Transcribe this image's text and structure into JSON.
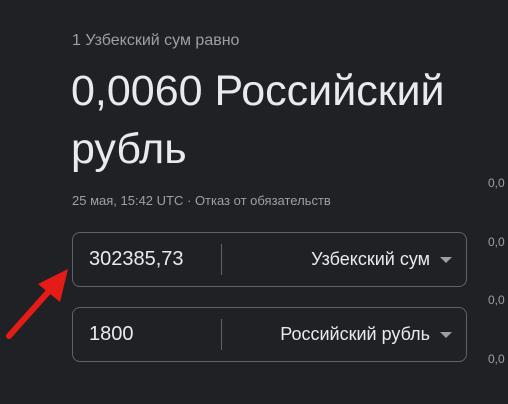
{
  "converter": {
    "subtitle": "1 Узбекский сум равно",
    "result": "0,0060 Российский рубль",
    "timestamp": "25 мая, 15:42 UTC",
    "separator": " · ",
    "disclaimer": "Отказ от обязательств",
    "from": {
      "amount": "302385,73",
      "currency": "Узбекский сум"
    },
    "to": {
      "amount": "1800",
      "currency": "Российский рубль"
    }
  },
  "chart_axis": {
    "labels": [
      "0,0",
      "0,0",
      "0,0",
      "0,0"
    ]
  },
  "annotation": {
    "arrow_color": "#e41b17"
  }
}
